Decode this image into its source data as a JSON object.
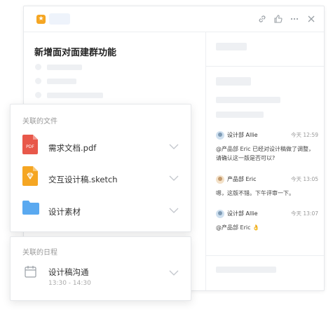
{
  "task": {
    "title": "新增面对面建群功能"
  },
  "comments": [
    {
      "author": "设计部 Allie",
      "time": "今天 12:59",
      "text": "@产品部 Eric 已经对设计稿做了调整，请确认这一版是否可以?"
    },
    {
      "author": "产品部 Eric",
      "time": "今天 13:05",
      "text": "嗯，这版不错。下午评审一下。"
    },
    {
      "author": "设计部 Allie",
      "time": "今天 13:07",
      "text": "@产品部 Eric 👌"
    }
  ],
  "files": {
    "title": "关联的文件",
    "items": [
      {
        "name": "需求文档.pdf",
        "icon": "pdf-file-icon",
        "badge": "PDF"
      },
      {
        "name": "交互设计稿.sketch",
        "icon": "sketch-file-icon"
      },
      {
        "name": "设计素材",
        "icon": "folder-icon"
      }
    ]
  },
  "schedule": {
    "title": "关联的日程",
    "event": "设计稿沟通",
    "time": "13:30 - 14:30"
  },
  "colors": {
    "accent_star": "#f5a623",
    "pdf": "#e8584a",
    "sketch": "#f5a623",
    "folder": "#5aa9f0"
  }
}
